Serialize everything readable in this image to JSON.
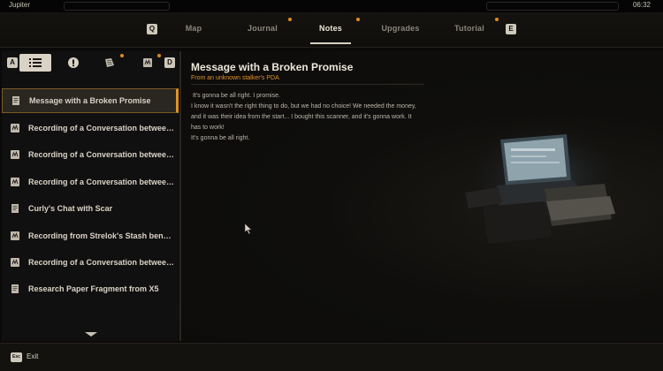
{
  "status": {
    "location": "Jupiter",
    "time": "06:32"
  },
  "nav": {
    "left_key": "Q",
    "right_key": "E",
    "tabs": [
      {
        "label": "Map",
        "active": false,
        "dot": false
      },
      {
        "label": "Journal",
        "active": false,
        "dot": true
      },
      {
        "label": "Notes",
        "active": true,
        "dot": true
      },
      {
        "label": "Upgrades",
        "active": false,
        "dot": false
      },
      {
        "label": "Tutorial",
        "active": false,
        "dot": true
      }
    ]
  },
  "filters": {
    "left_key": "A",
    "right_key": "D",
    "buttons": [
      {
        "icon": "list-icon",
        "selected": true
      },
      {
        "icon": "exclamation-icon",
        "selected": false
      },
      {
        "icon": "document-icon",
        "selected": false,
        "dot": true
      },
      {
        "icon": "pda-icon",
        "selected": false,
        "dot": true
      }
    ]
  },
  "notes": [
    {
      "label": "Message with a Broken Promise",
      "icon": "note-icon",
      "selected": true
    },
    {
      "label": "Recording of a Conversation between Faustus",
      "icon": "pda-icon",
      "selected": false
    },
    {
      "label": "Recording of a Conversation between Faustus",
      "icon": "pda-icon",
      "selected": false
    },
    {
      "label": "Recording of a Conversation between Faustus",
      "icon": "pda-icon",
      "selected": false
    },
    {
      "label": "Curly's Chat with Scar",
      "icon": "note-icon",
      "selected": false
    },
    {
      "label": "Recording from Strelok's Stash beneath Ah...",
      "icon": "pda-icon",
      "selected": false
    },
    {
      "label": "Recording of a Conversation between Professor",
      "icon": "pda-icon",
      "selected": false
    },
    {
      "label": "Research Paper Fragment from X5",
      "icon": "note-icon",
      "selected": false
    }
  ],
  "detail": {
    "title": "Message with a Broken Promise",
    "subtitle": "From an unknown stalker's PDA",
    "body": [
      " It's gonna be all right. I promise.",
      "I know it wasn't the right thing to do, but we had no choice! We needed the money, and it was their idea from the start... I bought this scanner, and it's gonna work. It has to work!",
      "It's gonna be all right."
    ]
  },
  "footer": {
    "key": "Esc",
    "label": "Exit"
  },
  "colors": {
    "accent": "#e0902c",
    "panel": "#111010",
    "background": "#0b0a09"
  }
}
